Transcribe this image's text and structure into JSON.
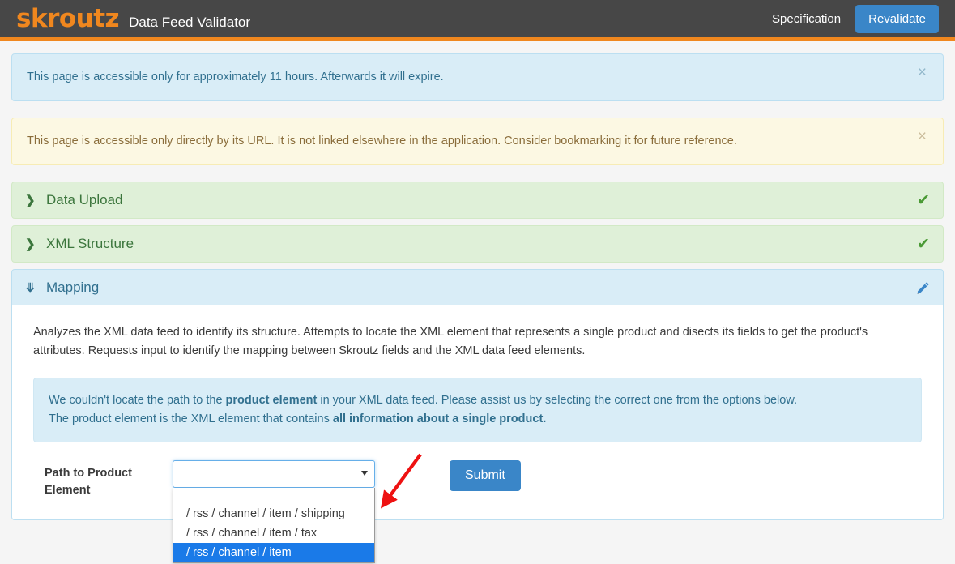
{
  "navbar": {
    "logo_text": "skroutz",
    "subtitle": "Data Feed Validator",
    "specification_link": "Specification",
    "revalidate_button": "Revalidate",
    "brand_color": "#f0871e",
    "bar_color": "#474747",
    "button_color": "#3a86c8"
  },
  "alerts": [
    {
      "type": "info",
      "text": "This page is accessible only for approximately 11 hours. Afterwards it will expire.",
      "close_label": "×",
      "bg_color": "#d9edf7",
      "text_color": "#31708f"
    },
    {
      "type": "warning",
      "text": "This page is accessible only directly by its URL. It is not linked elsewhere in the application. Consider bookmarking it for future reference.",
      "close_label": "×",
      "bg_color": "#fcf8e3",
      "text_color": "#8a6d3b"
    }
  ],
  "panels": [
    {
      "title": "Data Upload",
      "state": "complete",
      "chevron": "❯",
      "status_icon": "check-icon",
      "status_glyph": "✔",
      "bg_color": "#dff0d8"
    },
    {
      "title": "XML Structure",
      "state": "complete",
      "chevron": "❯",
      "status_icon": "check-icon",
      "status_glyph": "✔",
      "bg_color": "#dff0d8"
    },
    {
      "title": "Mapping",
      "state": "expanded",
      "chevron": "❯",
      "status_icon": "pencil-icon",
      "bg_color": "#d9edf7"
    }
  ],
  "mapping": {
    "description": "Analyzes the XML data feed to identify its structure. Attempts to locate the XML element that represents a single product and disects its fields to get the product's attributes. Requests input to identify the mapping between Skroutz fields and the XML data feed elements.",
    "notice": {
      "line1_part1": "We couldn't locate the path to the ",
      "line1_bold": "product element",
      "line1_part2": " in your XML data feed. Please assist us by selecting the correct one from the options below.",
      "line2_part1": "The product element is the XML element that contains ",
      "line2_bold": "all information about a single product."
    },
    "form": {
      "label": "Path to Product Element",
      "select_name": "path-to-product-element",
      "selected_value": "",
      "dropdown_open": true,
      "options": [
        {
          "label": "",
          "selected": false,
          "blank": true
        },
        {
          "label": "/ rss / channel / item / shipping",
          "selected": false
        },
        {
          "label": "/ rss / channel / item / tax",
          "selected": false
        },
        {
          "label": "/ rss / channel / item",
          "selected": true
        }
      ],
      "highlight_color": "#1a7ae8",
      "submit_button": "Submit"
    }
  },
  "annotation": {
    "arrow_color": "#ee1111",
    "description": "red arrow pointing to the highlighted dropdown option"
  }
}
